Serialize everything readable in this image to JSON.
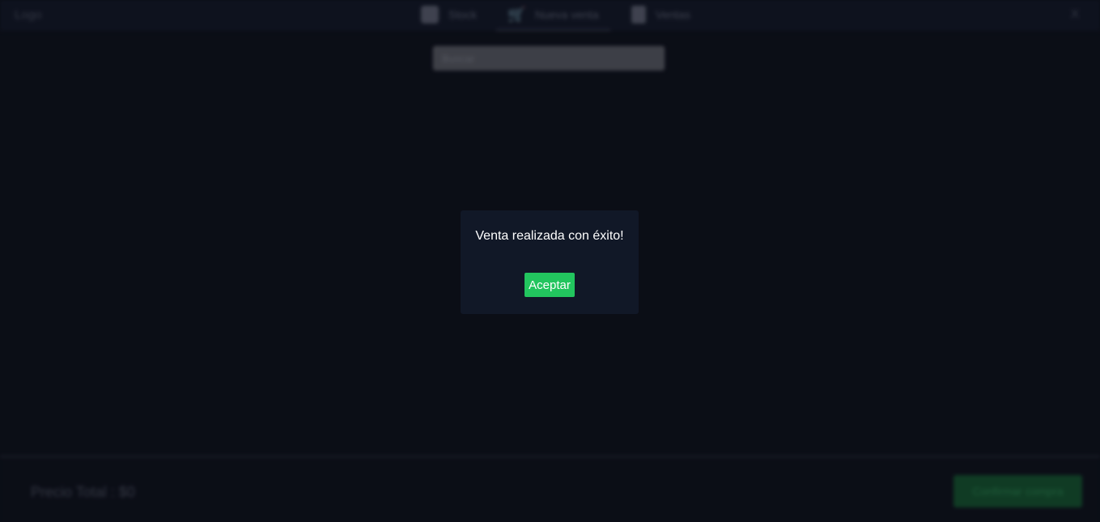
{
  "navbar": {
    "logo": "Logo",
    "items": [
      {
        "label": "Stock",
        "icon": "box-icon",
        "active": false
      },
      {
        "label": "Nueva venta",
        "icon": "cart-icon",
        "active": true
      },
      {
        "label": "Ventas",
        "icon": "receipt-icon",
        "active": false
      }
    ],
    "close_label": "X"
  },
  "search": {
    "placeholder": "Buscar",
    "value": ""
  },
  "footer": {
    "total_label": "Precio Total : $0",
    "confirm_label": "Confirmar compra"
  },
  "modal": {
    "message": "Venta realizada con éxito!",
    "button_label": "Aceptar"
  },
  "colors": {
    "background": "#0d111a",
    "modal_bg": "#111827",
    "accent_green": "#22c55e"
  }
}
